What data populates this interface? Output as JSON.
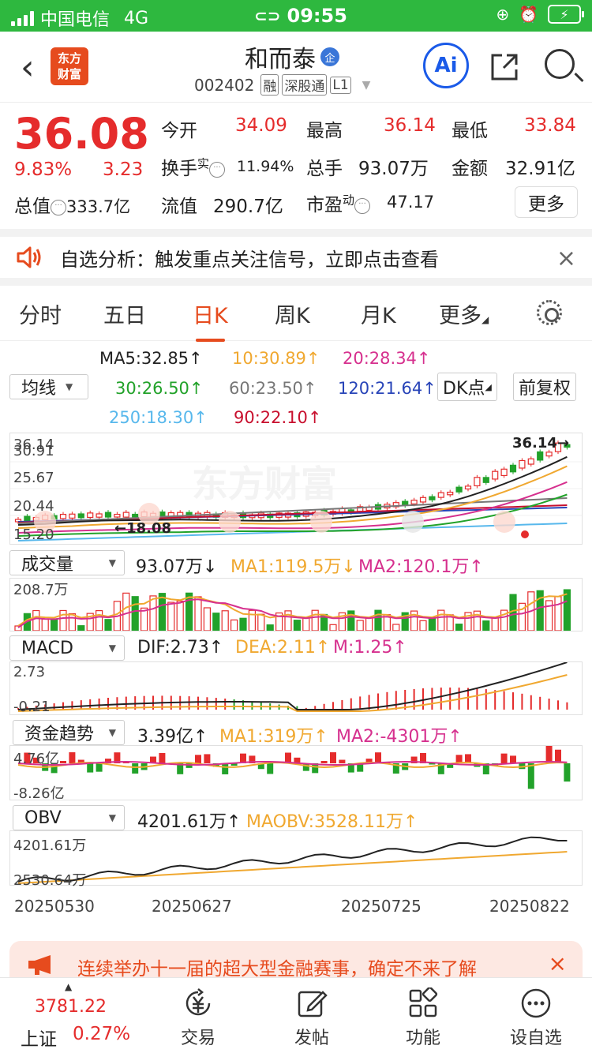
{
  "status_bar": {
    "carrier": "中国电信",
    "network": "4G",
    "time": "09:55",
    "battery": "⚡"
  },
  "header": {
    "logo_line1": "东方",
    "logo_line2": "财富",
    "stock_name": "和而泰",
    "enterprise_badge": "企",
    "stock_code": "002402",
    "tags": [
      "融",
      "深股通",
      "L1"
    ],
    "ai_label": "Ai"
  },
  "quote": {
    "price": "36.08",
    "change_pct": "9.83%",
    "change": "3.23",
    "open_label": "今开",
    "open": "34.09",
    "high_label": "最高",
    "high": "36.14",
    "low_label": "最低",
    "low": "33.84",
    "turnover_label": "换手",
    "turnover_sup": "实",
    "turnover": "11.94%",
    "volume_label": "总手",
    "volume": "93.07万",
    "amount_label": "金额",
    "amount": "32.91亿",
    "mcap_label": "总值",
    "mcap": "333.7亿",
    "float_label": "流值",
    "float_cap": "290.7亿",
    "pe_label": "市盈",
    "pe_sup": "动",
    "pe": "47.17",
    "more_label": "更多"
  },
  "alert": {
    "text": "自选分析：触发重点关注信号，立即点击查看",
    "close": "×"
  },
  "tabs": [
    "分时",
    "五日",
    "日K",
    "周K",
    "月K",
    "更多"
  ],
  "active_tab": "日K",
  "ma_legend": {
    "ma5": "MA5:32.85↑",
    "ma10": "10:30.89↑",
    "ma20": "20:28.34↑",
    "ma30": "30:26.50↑",
    "ma60": "60:23.50↑",
    "ma120": "120:21.64↑",
    "ma250": "250:18.30↑",
    "ma90": "90:22.10↑",
    "selector": "均线",
    "dk_label": "DK点",
    "adjust_label": "前复权",
    "colors": {
      "ma5": "#222222",
      "ma10": "#f0a830",
      "ma20": "#d6308e",
      "ma30": "#22a22a",
      "ma60": "#777777",
      "ma120": "#2844b8",
      "ma250": "#58b8ec",
      "ma90": "#c8102e"
    }
  },
  "kline": {
    "y_labels": [
      "36.14",
      "30.91",
      "25.67",
      "20.44",
      "15.20"
    ],
    "high_marker": "36.14",
    "low_marker": "18.08",
    "watermark": "东方财富"
  },
  "volume_panel": {
    "selector": "成交量",
    "value": "93.07万↓",
    "ma1": "MA1:119.5万↓",
    "ma2": "MA2:120.1万↑",
    "y_label": "208.7万"
  },
  "macd_panel": {
    "selector": "MACD",
    "dif": "DIF:2.73↑",
    "dea": "DEA:2.11↑",
    "m": "M:1.25↑",
    "y_top": "2.73",
    "y_bottom": "-0.21"
  },
  "fund_panel": {
    "selector": "资金趋势",
    "value": "3.39亿↑",
    "ma1": "MA1:319万↑",
    "ma2": "MA2:-4301万↑",
    "y_top": "4.76亿",
    "y_bottom": "-8.26亿"
  },
  "obv_panel": {
    "selector": "OBV",
    "value": "4201.61万↑",
    "maobv": "MAOBV:3528.11万↑",
    "y_top": "4201.61万",
    "y_bottom": "2530.64万"
  },
  "dates": [
    "20250530",
    "20250627",
    "20250725",
    "20250822"
  ],
  "ad": {
    "text": "连续举办十一届的超大型金融赛事，确定不来了解",
    "close": "×"
  },
  "bottom_nav": {
    "index_value": "3781.22",
    "index_name": "上证",
    "index_pct": "0.27%",
    "items": [
      "交易",
      "发帖",
      "功能",
      "设自选"
    ]
  }
}
